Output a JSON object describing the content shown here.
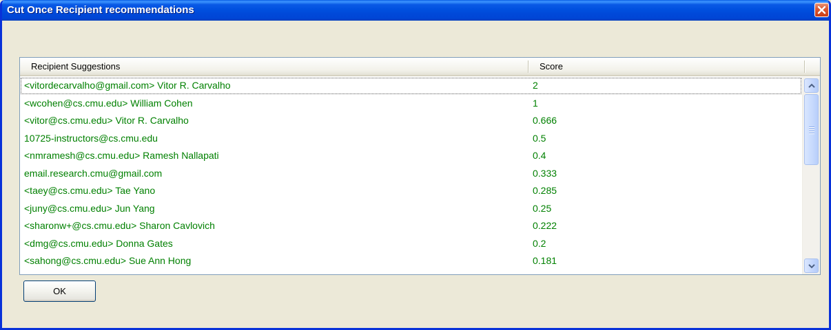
{
  "window": {
    "title": "Cut Once Recipient recommendations"
  },
  "list": {
    "columns": [
      "Recipient Suggestions",
      "Score"
    ],
    "rows": [
      {
        "recipient": "<vitordecarvalho@gmail.com> Vitor R. Carvalho",
        "score": "2",
        "selected": true
      },
      {
        "recipient": "<wcohen@cs.cmu.edu> William Cohen",
        "score": "1"
      },
      {
        "recipient": "<vitor@cs.cmu.edu> Vitor R. Carvalho",
        "score": "0.666"
      },
      {
        "recipient": "10725-instructors@cs.cmu.edu",
        "score": "0.5"
      },
      {
        "recipient": "<nmramesh@cs.cmu.edu> Ramesh Nallapati",
        "score": "0.4"
      },
      {
        "recipient": "email.research.cmu@gmail.com",
        "score": "0.333"
      },
      {
        "recipient": "<taey@cs.cmu.edu> Tae Yano",
        "score": "0.285"
      },
      {
        "recipient": "<juny@cs.cmu.edu> Jun Yang",
        "score": "0.25"
      },
      {
        "recipient": "<sharonw+@cs.cmu.edu> Sharon Cavlovich",
        "score": "0.222"
      },
      {
        "recipient": "<dmg@cs.cmu.edu> Donna Gates",
        "score": "0.2"
      },
      {
        "recipient": "<sahong@cs.cmu.edu> Sue Ann Hong",
        "score": "0.181"
      }
    ]
  },
  "buttons": {
    "ok_label": "OK"
  },
  "colors": {
    "row_text": "#008000",
    "titlebar": "#0050df",
    "close": "#dc5a34"
  },
  "icons": {
    "close": "close-icon",
    "scroll_up": "chevron-up-icon",
    "scroll_down": "chevron-down-icon"
  }
}
